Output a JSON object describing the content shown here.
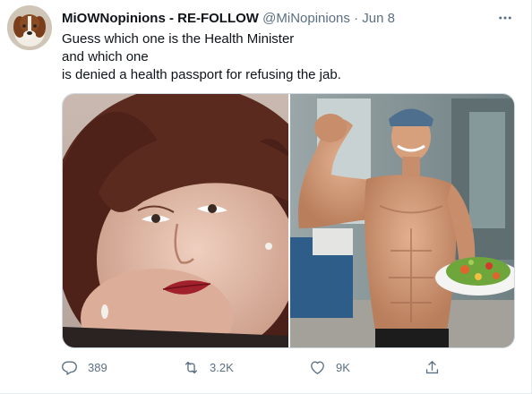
{
  "tweet": {
    "display_name": "MiOWNopinions - RE-FOLLOW",
    "handle": "@MiNopinions",
    "separator": "·",
    "date": "Jun 8",
    "text_lines": [
      "Guess which one is the Health Minister",
      "and which one",
      "is denied a health passport for refusing the jab."
    ],
    "stats": {
      "replies": "389",
      "retweets": "3.2K",
      "likes": "9K"
    }
  },
  "icons": {
    "more": "more-icon",
    "reply": "reply-icon",
    "retweet": "retweet-icon",
    "like": "heart-icon",
    "share": "share-icon"
  },
  "colors": {
    "text": "#0f1419",
    "secondary": "#5b7083",
    "border": "#cfd9de"
  }
}
